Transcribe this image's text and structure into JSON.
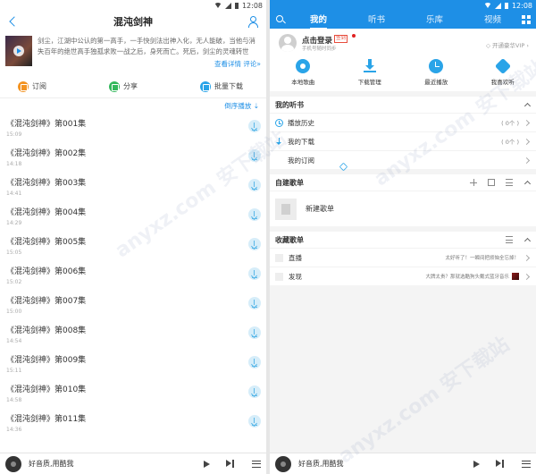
{
  "status_time": "12:08",
  "left": {
    "title": "混沌剑神",
    "description": "剑尘，江湖中公认的第一高手，一手快剑法出神入化，无人能破，当他与消失百年的绝世高手独孤求败一战之后，身死而亡。死后，剑尘的灵魂转世",
    "detail_link": "查看详情 评论»",
    "actions": [
      {
        "label": "订阅"
      },
      {
        "label": "分享"
      },
      {
        "label": "批量下载"
      }
    ],
    "sort_label": "倒序播放 ⇣",
    "episodes": [
      {
        "title": "《混沌剑神》第001集",
        "time": "15:09"
      },
      {
        "title": "《混沌剑神》第002集",
        "time": "14:18"
      },
      {
        "title": "《混沌剑神》第003集",
        "time": "14:41"
      },
      {
        "title": "《混沌剑神》第004集",
        "time": "14:29"
      },
      {
        "title": "《混沌剑神》第005集",
        "time": "15:05"
      },
      {
        "title": "《混沌剑神》第006集",
        "time": "15:02"
      },
      {
        "title": "《混沌剑神》第007集",
        "time": "15:00"
      },
      {
        "title": "《混沌剑神》第008集",
        "time": "14:54"
      },
      {
        "title": "《混沌剑神》第009集",
        "time": "15:11"
      },
      {
        "title": "《混沌剑神》第010集",
        "time": "14:58"
      },
      {
        "title": "《混沌剑神》第011集",
        "time": "14:36"
      }
    ],
    "player_name": "好音质,用酷我"
  },
  "right": {
    "tabs": [
      {
        "label": "我的"
      },
      {
        "label": "听书"
      },
      {
        "label": "乐库"
      },
      {
        "label": "视频"
      }
    ],
    "login_label": "点击登录",
    "login_tag": "签到",
    "login_sub": "手机号随时同步",
    "vip_label": "◇ 开通豪华VIP ›",
    "quick": [
      {
        "label": "本地歌曲"
      },
      {
        "label": "下载管理"
      },
      {
        "label": "最近播放"
      },
      {
        "label": "我喜欢听"
      }
    ],
    "my_books": {
      "heading": "我的听书",
      "rows": [
        {
          "label": "播放历史",
          "count": "( 0个 )"
        },
        {
          "label": "我的下载",
          "count": "( 0个 )"
        },
        {
          "label": "我的订阅",
          "count": ""
        }
      ]
    },
    "playlists": {
      "heading": "自建歌单",
      "new_label": "新建歌单"
    },
    "favorites": {
      "heading": "收藏歌单",
      "rows": [
        {
          "label": "直播",
          "note": "太好听了！一瞬间把烦恼全忘掉！"
        },
        {
          "label": "发现",
          "note": "大牌太贵？那就选酷狗头戴式蓝牙音乐"
        }
      ]
    },
    "player_name": "好音质,用酷我"
  },
  "watermark": "anyxz.com 安下载站"
}
